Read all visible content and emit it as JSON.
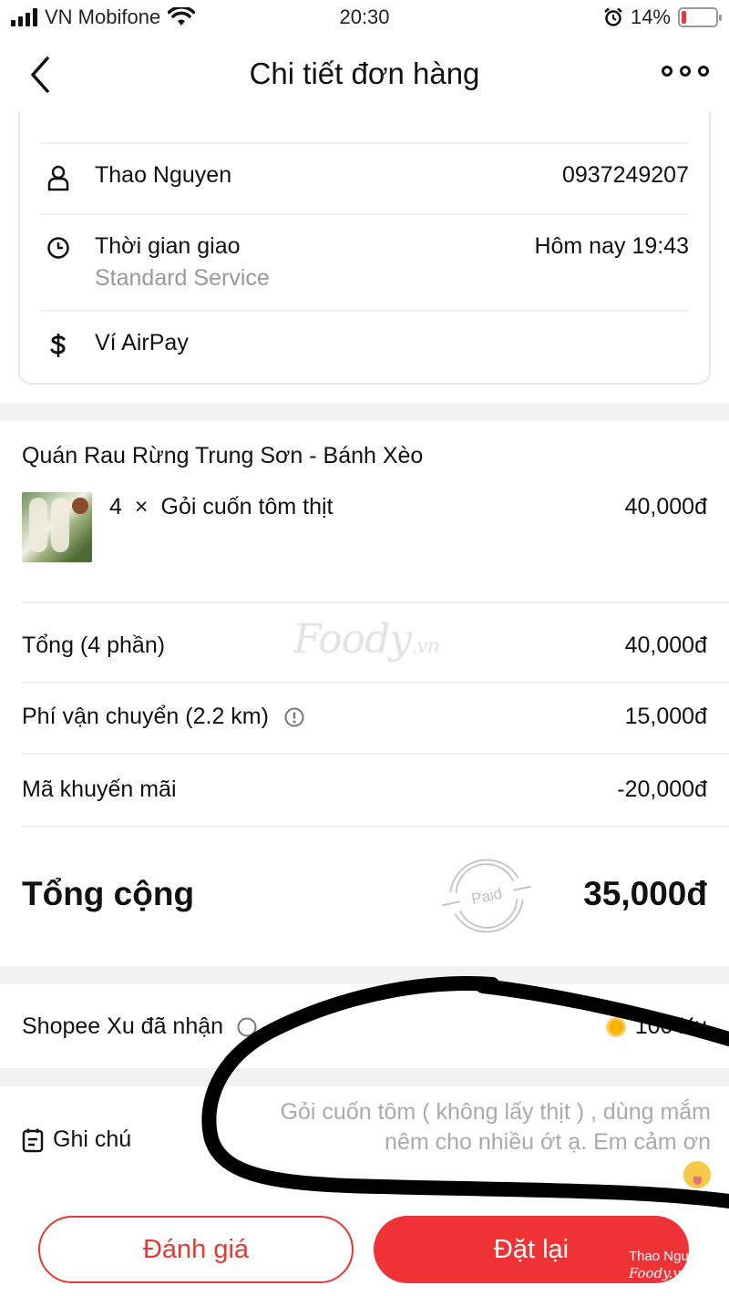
{
  "status_bar": {
    "carrier": "VN Mobifone",
    "time": "20:30",
    "battery": "14%",
    "battery_level": 0.14
  },
  "header": {
    "title": "Chi tiết đơn hàng"
  },
  "delivery_info": {
    "recipient_name": "Thao Nguyen",
    "phone": "0937249207",
    "delivery_time_label": "Thời gian giao",
    "service": "Standard Service",
    "delivery_time_value": "Hôm nay 19:43",
    "payment_method": "Ví AirPay"
  },
  "order": {
    "shop_name": "Quán Rau Rừng Trung Sơn - Bánh Xèo",
    "items": [
      {
        "qty": "4",
        "times": "×",
        "name": "Gỏi cuốn tôm thịt",
        "price": "40,000đ"
      }
    ]
  },
  "summary": {
    "subtotal_label": "Tổng (4 phần)",
    "subtotal_value": "40,000đ",
    "shipping_label": "Phí vận chuyển (2.2 km)",
    "shipping_value": "15,000đ",
    "promo_label": "Mã khuyến mãi",
    "promo_value": "-20,000đ",
    "total_label": "Tổng cộng",
    "total_value": "35,000đ",
    "paid_stamp": "Paid"
  },
  "watermark": {
    "brand": "Foody",
    "suffix": ".vn"
  },
  "shopee_xu": {
    "label": "Shopee Xu đã nhận",
    "value": "100 Xu"
  },
  "note": {
    "label": "Ghi chú",
    "text": "Gỏi cuốn tôm ( không lấy thịt ) , dùng mắm nêm cho nhiều ớt ạ. Em cảm ơn"
  },
  "actions": {
    "rate_label": "Đánh giá",
    "reorder_label": "Đặt lại"
  },
  "corner_watermark": {
    "user": "Thao Nguyen",
    "brand": "Foody.vn"
  },
  "colors": {
    "accent": "#ee3236",
    "divider": "#eeeeee",
    "muted_text": "#999999",
    "coin": "#ffb300"
  },
  "icons": {
    "back": "chevron-left-icon",
    "more": "more-dots-icon",
    "person": "person-icon",
    "clock": "clock-icon",
    "money": "dollar-icon",
    "info": "info-icon",
    "note": "note-icon",
    "coin": "coin-icon"
  }
}
